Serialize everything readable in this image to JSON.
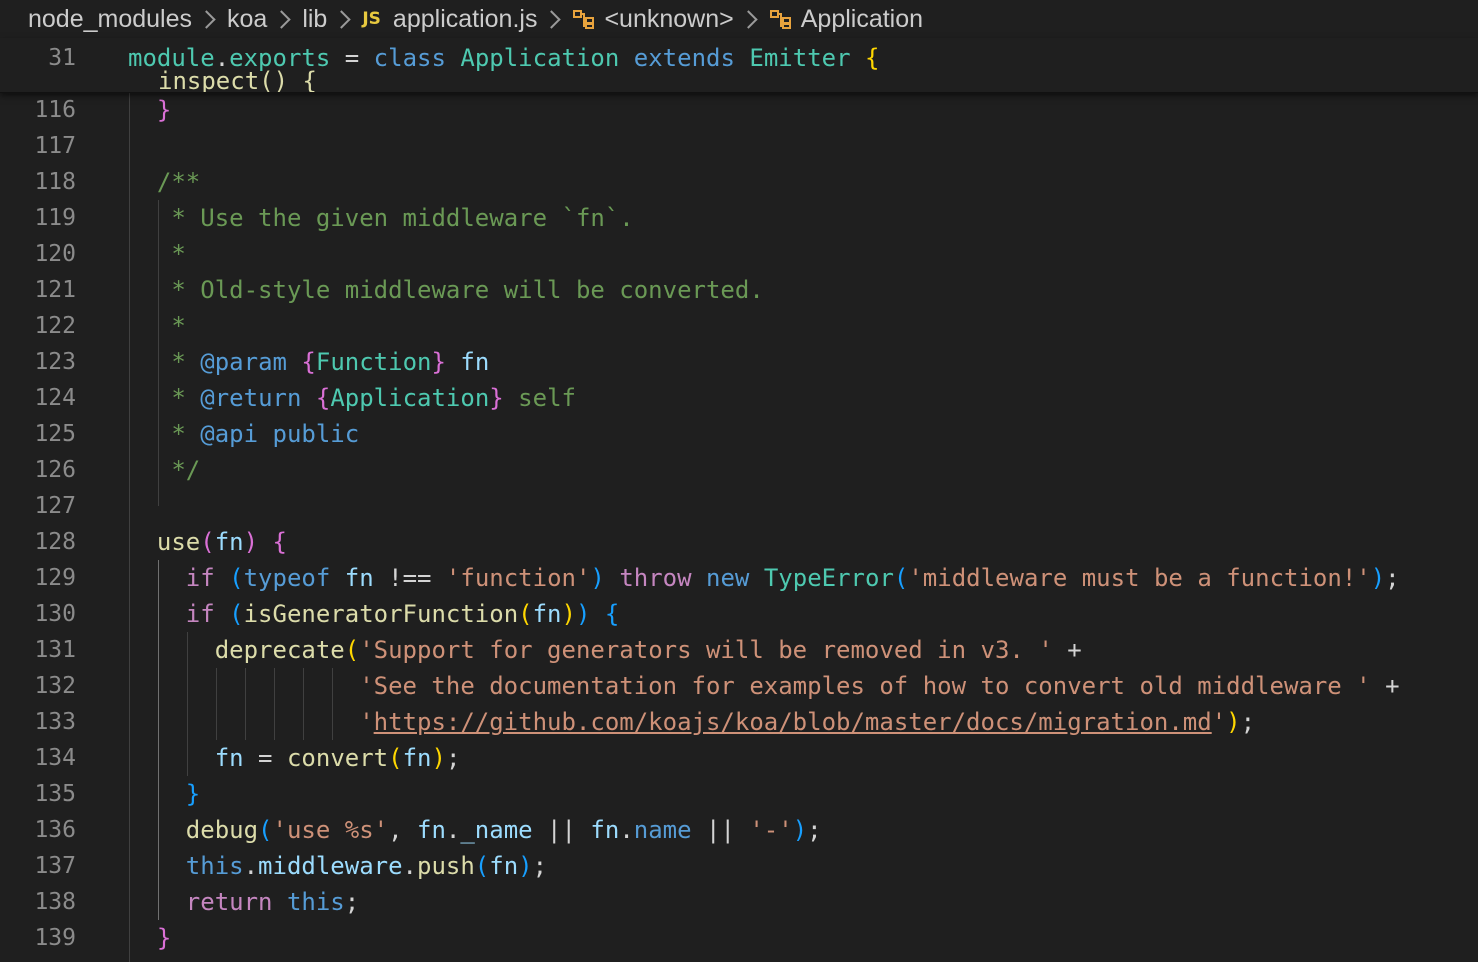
{
  "breadcrumb": {
    "items": [
      "node_modules",
      "koa",
      "lib",
      "application.js",
      "<unknown>",
      "Application"
    ],
    "file_badge": "JS"
  },
  "sticky": {
    "line_number": "31",
    "ghost_text": "inspect() {"
  },
  "editor": {
    "lines": [
      {
        "n": "116"
      },
      {
        "n": "117"
      },
      {
        "n": "118"
      },
      {
        "n": "119"
      },
      {
        "n": "120"
      },
      {
        "n": "121"
      },
      {
        "n": "122"
      },
      {
        "n": "123"
      },
      {
        "n": "124"
      },
      {
        "n": "125"
      },
      {
        "n": "126"
      },
      {
        "n": "127"
      },
      {
        "n": "128"
      },
      {
        "n": "129"
      },
      {
        "n": "130"
      },
      {
        "n": "131"
      },
      {
        "n": "132"
      },
      {
        "n": "133"
      },
      {
        "n": "134"
      },
      {
        "n": "135"
      },
      {
        "n": "136"
      },
      {
        "n": "137"
      },
      {
        "n": "138"
      },
      {
        "n": "139"
      }
    ]
  },
  "tok": {
    "module": "module",
    "dot": ".",
    "exports": "exports",
    "eq": " = ",
    "class": "class",
    "sp": " ",
    "Application": "Application",
    "extends": "extends",
    "Emitter": "Emitter",
    "lbrace": "{",
    "rbrace": "}",
    "c118": "/**",
    "c119": "* Use the given middleware `fn`.",
    "star": "*",
    "c121": "* Old-style middleware will be converted.",
    "c123a": "* ",
    "param": "@param",
    "c123b": " ",
    "Function": "Function",
    "c123c": " ",
    "fn": "fn",
    "c124a": "* ",
    "return": "@return",
    "c124b": " ",
    "self": " self",
    "c125a": "* ",
    "api": "@api",
    "public": " public",
    "c126": "*/",
    "use": "use",
    "lparen": "(",
    "rparen": ")",
    "if": "if",
    "typeof": "typeof",
    "neq": " !== ",
    "s_function": "'function'",
    "throw": "throw",
    "new": "new",
    "TypeError": "TypeError",
    "s_mw": "'middleware must be a function!'",
    "semi": ";",
    "isGeneratorFunction": "isGeneratorFunction",
    "deprecate": "deprecate",
    "s131": "'Support for generators will be removed in v3. '",
    "plus": " +",
    "s132": "'See the documentation for examples of how to convert old middleware '",
    "q": "'",
    "url": "https://github.com/koajs/koa/blob/master/docs/migration.md",
    "convert": "convert",
    "assign": " = ",
    "debug": "debug",
    "s136a": "'use %s'",
    "comma": ", ",
    "_name": "_name",
    "or": " || ",
    "name": "name",
    "s136b": "'-'",
    "this": "this",
    "middleware": "middleware",
    "push": "push",
    "return_kw": "return"
  },
  "colors": {
    "background": "#1f1f1f",
    "keyword": "#569cd6",
    "control": "#c586c0",
    "type": "#4ec9b0",
    "function": "#dcdcaa",
    "variable": "#9cdcfe",
    "string": "#ce9178",
    "comment": "#6a9955",
    "bracket_gold": "#ffd700",
    "bracket_orchid": "#da70d6",
    "bracket_blue": "#179fff"
  }
}
